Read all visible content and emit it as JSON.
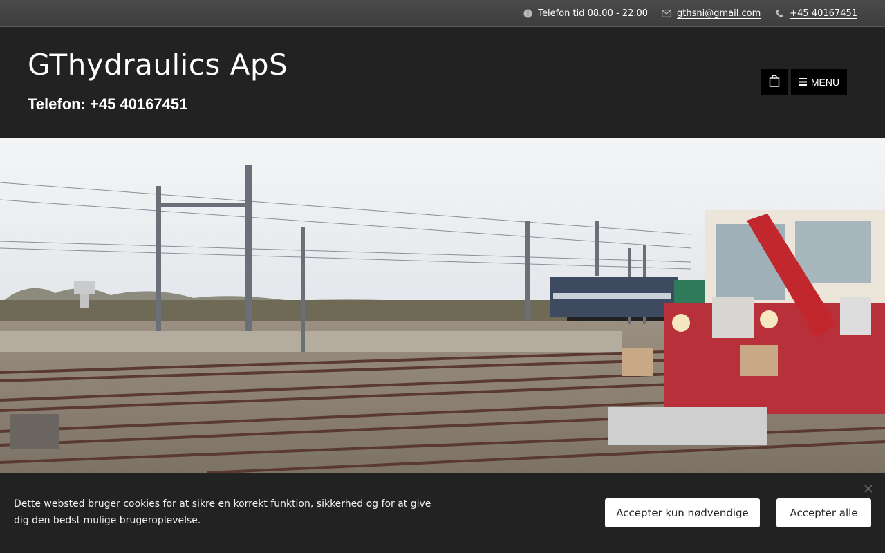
{
  "topbar": {
    "hours": "Telefon tid 08.00 - 22.00",
    "email": "gthsni@gmail.com",
    "phone": "+45 40167451"
  },
  "header": {
    "title": "GThydraulics ApS",
    "subtitle": "Telefon: +45 40167451",
    "menu_label": "MENU"
  },
  "cookie": {
    "text": "Dette websted bruger cookies for at sikre en korrekt funktion, sikkerhed og for at give dig den bedst mulige brugeroplevelse.",
    "accept_necessary": "Accepter kun nødvendige",
    "accept_all": "Accepter alle"
  },
  "icons": {
    "info": "info-icon",
    "email": "mail-icon",
    "phone": "phone-icon",
    "cart": "shopping-bag-icon",
    "menu": "hamburger-icon",
    "close": "close-icon"
  },
  "colors": {
    "header_bg": "#222222",
    "topbar_bg": "#444444",
    "button_bg": "#000000"
  }
}
